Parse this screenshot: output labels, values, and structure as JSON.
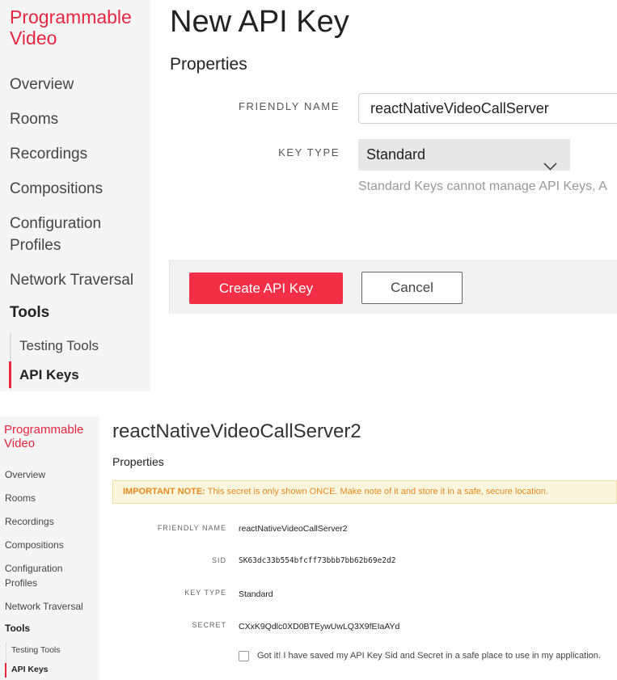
{
  "colors": {
    "brand": "#e8263f",
    "primary_button": "#f22f46",
    "note_text": "#e58a20"
  },
  "top": {
    "sidebar": {
      "brand": "Programmable Video",
      "items": [
        "Overview",
        "Rooms",
        "Recordings",
        "Compositions",
        "Configuration Profiles",
        "Network Traversal"
      ],
      "tools": "Tools",
      "sub_items": [
        "Testing Tools",
        "API Keys"
      ]
    },
    "title": "New API Key",
    "section": "Properties",
    "friendly_name_label": "FRIENDLY NAME",
    "friendly_name_value": "reactNativeVideoCallServer",
    "key_type_label": "KEY TYPE",
    "key_type_value": "Standard",
    "key_type_help": "Standard Keys cannot manage API Keys, A",
    "create_button": "Create API Key",
    "cancel_button": "Cancel"
  },
  "bottom": {
    "sidebar": {
      "brand": "Programmable Video",
      "items": [
        "Overview",
        "Rooms",
        "Recordings",
        "Compositions",
        "Configuration Profiles",
        "Network Traversal"
      ],
      "tools": "Tools",
      "sub_items": [
        "Testing Tools",
        "API Keys"
      ]
    },
    "title": "reactNativeVideoCallServer2",
    "section": "Properties",
    "note_strong": "IMPORTANT NOTE:",
    "note_text": " This secret is only shown ONCE. Make note of it and store it in a safe, secure location.",
    "friendly_name_label": "FRIENDLY NAME",
    "friendly_name_value": "reactNativeVideoCallServer2",
    "sid_label": "SID",
    "sid_value": "SK63dc33b554bfcff73bbb7bb62b69e2d2",
    "key_type_label": "KEY TYPE",
    "key_type_value": "Standard",
    "secret_label": "SECRET",
    "secret_value": "CXxK9Qdlc0XD0BTEywUwLQ3X9fEIaAYd",
    "confirm_label": "Got it! I have saved my API Key Sid and Secret in a safe place to use in my application."
  }
}
